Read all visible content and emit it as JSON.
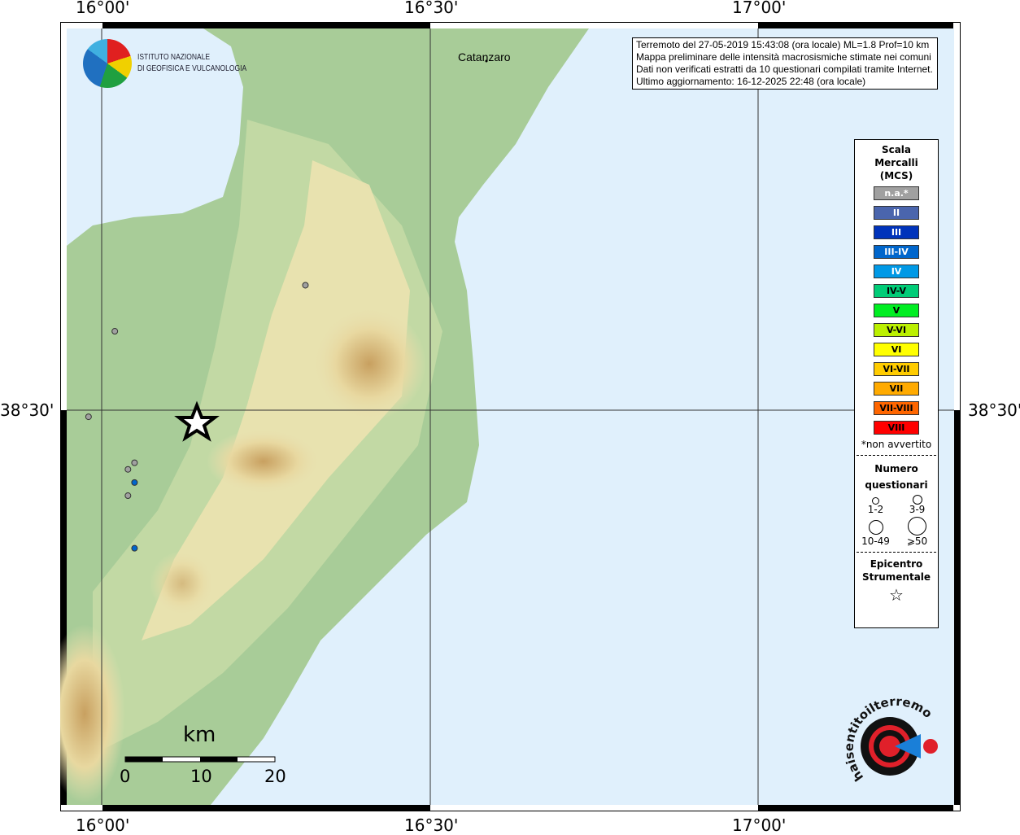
{
  "ticks": {
    "top": [
      "16°00'",
      "16°30'",
      "17°00'"
    ],
    "bottom": [
      "16°00'",
      "16°30'",
      "17°00'"
    ],
    "left": "38°30'",
    "right": "38°30'"
  },
  "place": "Catanzaro",
  "logo": {
    "line1": "ISTITUTO NAZIONALE",
    "line2": "DI GEOFISICA E VULCANOLOGIA"
  },
  "info": [
    "Terremoto del 27-05-2019 15:43:08 (ora locale) ML=1.8 Prof=10 km",
    "Mappa preliminare delle intensità macrosismiche stimate nei comuni",
    "Dati non verificati estratti da 10 questionari compilati tramite Internet.",
    "Ultimo aggiornamento: 16-12-2025 22:48 (ora locale)"
  ],
  "legend": {
    "title": [
      "Scala",
      "Mercalli",
      "(MCS)"
    ],
    "scale": [
      {
        "label": "n.a.*",
        "color": "#a0a0a0",
        "text": "#ffffff"
      },
      {
        "label": "II",
        "color": "#4a65ad",
        "text": "#ffffff"
      },
      {
        "label": "III",
        "color": "#0033bb",
        "text": "#ffffff"
      },
      {
        "label": "III-IV",
        "color": "#0066cc",
        "text": "#ffffff"
      },
      {
        "label": "IV",
        "color": "#0099e6",
        "text": "#ffffff"
      },
      {
        "label": "IV-V",
        "color": "#00cc77",
        "text": "#000000"
      },
      {
        "label": "V",
        "color": "#00ee22",
        "text": "#000000"
      },
      {
        "label": "V-VI",
        "color": "#bbf000",
        "text": "#000000"
      },
      {
        "label": "VI",
        "color": "#ffff00",
        "text": "#000000"
      },
      {
        "label": "VI-VII",
        "color": "#ffcc00",
        "text": "#000000"
      },
      {
        "label": "VII",
        "color": "#ffaa00",
        "text": "#000000"
      },
      {
        "label": "VII-VIII",
        "color": "#ff6600",
        "text": "#000000"
      },
      {
        "label": "VIII",
        "color": "#ff0000",
        "text": "#000000"
      }
    ],
    "note": "*non avvertito",
    "count_title": [
      "Numero",
      "questionari"
    ],
    "counts": [
      "1-2",
      "3-9",
      "10-49",
      "⩾50"
    ],
    "epi_title": [
      "Epicentro",
      "Strumentale"
    ]
  },
  "scalebar": {
    "unit": "km",
    "labels": [
      "0",
      "10",
      "20"
    ]
  },
  "observations": [
    {
      "lon": 16.31,
      "lat": 38.69,
      "intensity": "n.a.*"
    },
    {
      "lon": 16.02,
      "lat": 38.62,
      "intensity": "n.a.*"
    },
    {
      "lon": 15.98,
      "lat": 38.49,
      "intensity": "n.a.*"
    },
    {
      "lon": 16.04,
      "lat": 38.41,
      "intensity": "n.a.*"
    },
    {
      "lon": 16.05,
      "lat": 38.42,
      "intensity": "n.a.*"
    },
    {
      "lon": 16.04,
      "lat": 38.37,
      "intensity": "n.a.*"
    },
    {
      "lon": 16.05,
      "lat": 38.39,
      "intensity": "III-IV"
    },
    {
      "lon": 16.05,
      "lat": 38.29,
      "intensity": "III-IV"
    }
  ],
  "epicenter": {
    "lon": 16.09,
    "lat": 38.49
  },
  "colors": {
    "sea": "#e0f0fc",
    "land": "#a8cc98",
    "highland": "#f0e6b8",
    "mountain": "#d4b070"
  }
}
